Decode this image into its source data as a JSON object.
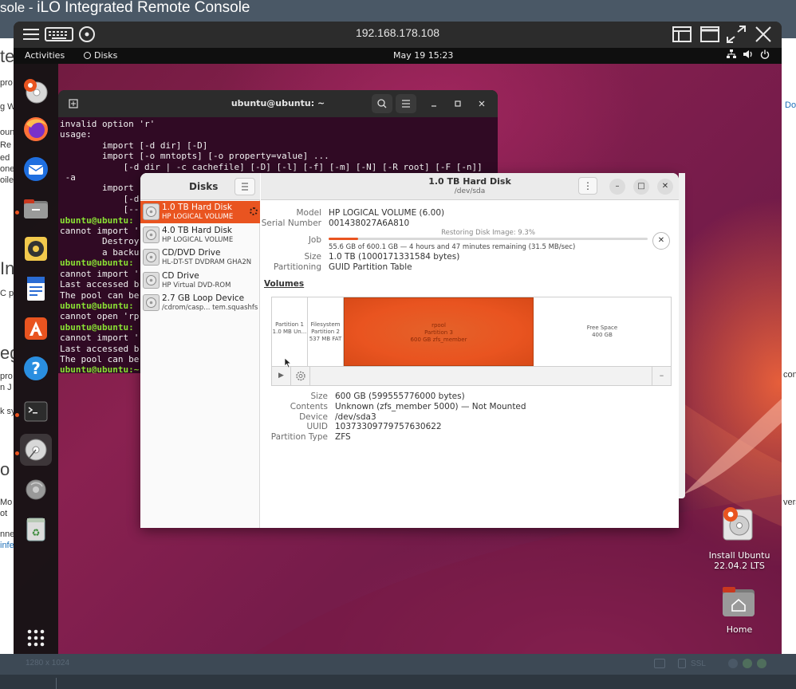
{
  "browser": {
    "title_prefix": "sole - ",
    "title_main": "iLO Integrated Remote Console",
    "bg_fragments": [
      "te",
      "pro",
      "g W",
      "oun",
      "Re",
      "ed",
      "one",
      "oile",
      "In",
      "C p",
      "eg",
      "pro",
      "n J",
      "k sy",
      "o",
      "Mo",
      "ot",
      "nne",
      "infe",
      "Do",
      "con",
      "vers"
    ],
    "bottom_resolution": "1280 x 1024",
    "bottom_ssl": "SSL"
  },
  "ilo": {
    "address": "192.168.178.108",
    "toolbar_left": [
      "menu-icon",
      "keyboard-icon",
      "disc-icon"
    ],
    "toolbar_right": [
      "window-layout-icon",
      "window-icon",
      "fullscreen-icon",
      "close-icon"
    ]
  },
  "topbar": {
    "activities": "Activities",
    "app_name": "Disks",
    "clock": "May 19  15:23"
  },
  "dock": {
    "apps": [
      "ubuntu-installer-icon",
      "firefox-icon",
      "thunderbird-icon",
      "files-icon",
      "rhythmbox-icon",
      "writer-icon",
      "app-center-icon",
      "help-icon",
      "terminal-icon",
      "disks-icon",
      "disk-image-icon",
      "trash-icon"
    ],
    "show_apps": "apps-grid-icon"
  },
  "terminal": {
    "title": "ubuntu@ubuntu: ~",
    "lines": [
      {
        "text": "invalid option 'r'",
        "type": "out"
      },
      {
        "text": "usage:",
        "type": "out"
      },
      {
        "text": "        import [-d dir] [-D]",
        "type": "out"
      },
      {
        "text": "        import [-o mntopts] [-o property=value] ...",
        "type": "out"
      },
      {
        "text": "            [-d dir | -c cachefile] [-D] [-l] [-f] [-m] [-N] [-R root] [-F [-n]]",
        "type": "out"
      },
      {
        "text": " -a",
        "type": "out"
      },
      {
        "text": "        import",
        "type": "out"
      },
      {
        "text": "            [-d",
        "type": "out"
      },
      {
        "text": "            [--",
        "type": "out"
      },
      {
        "text": "ubuntu@ubuntu:",
        "type": "prompt"
      },
      {
        "text": "cannot import '",
        "type": "out"
      },
      {
        "text": "        Destroy",
        "type": "out"
      },
      {
        "text": "        a backu",
        "type": "out"
      },
      {
        "text": "ubuntu@ubuntu:",
        "type": "prompt"
      },
      {
        "text": "cannot import '",
        "type": "out"
      },
      {
        "text": "Last accessed b",
        "type": "out"
      },
      {
        "text": "The pool can be",
        "type": "out"
      },
      {
        "text": "ubuntu@ubuntu:",
        "type": "prompt"
      },
      {
        "text": "cannot open 'rp",
        "type": "out"
      },
      {
        "text": "ubuntu@ubuntu:",
        "type": "prompt"
      },
      {
        "text": "cannot import '",
        "type": "out"
      },
      {
        "text": "Last accessed b",
        "type": "out"
      },
      {
        "text": "The pool can be",
        "type": "out"
      },
      {
        "text": "ubuntu@ubuntu:~",
        "type": "prompt"
      }
    ]
  },
  "disks": {
    "sidebar_title": "Disks",
    "header_title": "1.0 TB Hard Disk",
    "header_subtitle": "/dev/sda",
    "drives": [
      {
        "name": "1.0 TB Hard Disk",
        "sub": "HP LOGICAL VOLUME",
        "selected": true
      },
      {
        "name": "4.0 TB Hard Disk",
        "sub": "HP LOGICAL VOLUME",
        "selected": false
      },
      {
        "name": "CD/DVD Drive",
        "sub": "HL-DT-ST DVDRAM GHA2N",
        "selected": false
      },
      {
        "name": "CD Drive",
        "sub": "HP Virtual DVD-ROM",
        "selected": false
      },
      {
        "name": "2.7 GB Loop Device",
        "sub": "/cdrom/casp... tem.squashfs",
        "selected": false
      }
    ],
    "model_label": "Model",
    "model": "HP LOGICAL VOLUME (6.00)",
    "serial_label": "Serial Number",
    "serial": "001438027A6A810",
    "job_label": "Job",
    "job_title": "Restoring Disk Image: 9.3%",
    "job_progress": 0.093,
    "job_detail": "55.6 GB of 600.1 GB — 4 hours and 47 minutes remaining (31.5 MB/sec)",
    "size_label": "Size",
    "size": "1.0 TB (1000171331584 bytes)",
    "partitioning_label": "Partitioning",
    "partitioning": "GUID Partition Table",
    "volumes_title": "Volumes",
    "segments": [
      {
        "lines": [
          "Partition 1",
          "1.0 MB Un..."
        ]
      },
      {
        "lines": [
          "Filesystem",
          "Partition 2",
          "537 MB FAT"
        ]
      },
      {
        "lines": [
          "rpool",
          "Partition 3",
          "600 GB zfs_member"
        ]
      },
      {
        "lines": [
          "Free Space",
          "400 GB"
        ]
      }
    ],
    "vol_size_label": "Size",
    "vol_size": "600 GB (599555776000 bytes)",
    "vol_contents_label": "Contents",
    "vol_contents": "Unknown (zfs_member 5000) — Not Mounted",
    "vol_device_label": "Device",
    "vol_device": "/dev/sda3",
    "vol_uuid_label": "UUID",
    "vol_uuid": "10373309779757630622",
    "vol_ptype_label": "Partition Type",
    "vol_ptype": "ZFS"
  },
  "desktop_icons": [
    {
      "label_1": "Install Ubuntu",
      "label_2": "22.04.2 LTS"
    },
    {
      "label_1": "Home"
    }
  ],
  "colors": {
    "ubuntu_orange": "#e95420",
    "terminal_bg": "#300a24",
    "prompt_green": "#8ae234"
  }
}
